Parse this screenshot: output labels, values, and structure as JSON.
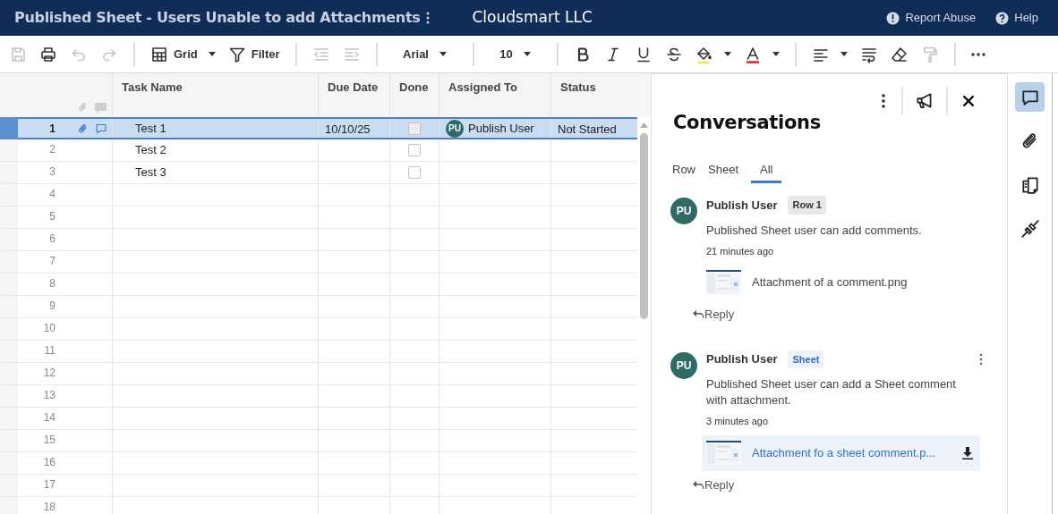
{
  "header": {
    "title": "Published Sheet - Users Unable to add Attachments",
    "company": "Cloudsmart LLC",
    "links": [
      {
        "kind": "report",
        "label": "Report Abuse"
      },
      {
        "kind": "help",
        "label": "Help"
      }
    ]
  },
  "toolbar": [
    {
      "kind": "save",
      "disabled": true
    },
    {
      "kind": "print",
      "disabled": false
    },
    {
      "kind": "undo",
      "disabled": true
    },
    {
      "kind": "redo",
      "disabled": true
    },
    {
      "kind": "sep"
    },
    {
      "kind": "grid",
      "label": "Grid",
      "disabled": false
    },
    {
      "kind": "filter",
      "label": "Filter",
      "disabled": false
    },
    {
      "kind": "sep"
    },
    {
      "kind": "outdent",
      "disabled": true
    },
    {
      "kind": "indent",
      "disabled": true
    },
    {
      "kind": "sep"
    },
    {
      "kind": "font",
      "label": "Arial",
      "disabled": false
    },
    {
      "kind": "sep"
    },
    {
      "kind": "size",
      "label": "10",
      "disabled": false
    },
    {
      "kind": "sep"
    },
    {
      "kind": "bold",
      "disabled": false
    },
    {
      "kind": "italic",
      "disabled": false
    },
    {
      "kind": "underline",
      "disabled": false
    },
    {
      "kind": "strike",
      "disabled": false
    },
    {
      "kind": "fill",
      "disabled": false
    },
    {
      "kind": "textcolor",
      "disabled": false
    },
    {
      "kind": "sep"
    },
    {
      "kind": "align",
      "disabled": false
    },
    {
      "kind": "wrap",
      "disabled": false
    },
    {
      "kind": "eraser",
      "disabled": false
    },
    {
      "kind": "paint",
      "disabled": true
    },
    {
      "kind": "sep"
    },
    {
      "kind": "more",
      "disabled": false
    }
  ],
  "grid": {
    "columns": [
      "Task Name",
      "Due Date",
      "Done",
      "Assigned To",
      "Status"
    ],
    "rows": [
      {
        "number": "1",
        "selected": true,
        "attachment": true,
        "comment": true,
        "task": "Test 1",
        "due": "10/10/25",
        "done": false,
        "assigned": {
          "initials": "PU",
          "name": "Publish User"
        },
        "status": "Not Started"
      },
      {
        "number": "2",
        "selected": false,
        "attachment": false,
        "comment": false,
        "task": "Test 2",
        "done": false
      },
      {
        "number": "3",
        "selected": false,
        "attachment": false,
        "comment": false,
        "task": "Test 3",
        "done": false
      },
      {
        "number": "4",
        "selected": false
      },
      {
        "number": "5",
        "selected": false
      },
      {
        "number": "6",
        "selected": false
      },
      {
        "number": "7",
        "selected": false
      },
      {
        "number": "8",
        "selected": false
      },
      {
        "number": "9",
        "selected": false
      },
      {
        "number": "10",
        "selected": false
      },
      {
        "number": "11",
        "selected": false
      },
      {
        "number": "12",
        "selected": false
      },
      {
        "number": "13",
        "selected": false
      },
      {
        "number": "14",
        "selected": false
      },
      {
        "number": "15",
        "selected": false
      },
      {
        "number": "16",
        "selected": false
      },
      {
        "number": "17",
        "selected": false
      },
      {
        "number": "18",
        "selected": false
      }
    ]
  },
  "conversations": {
    "title": "Conversations",
    "tabs": [
      {
        "label": "Row",
        "selected": false
      },
      {
        "label": "Sheet",
        "selected": false
      },
      {
        "label": "All",
        "selected": true
      }
    ],
    "comments": [
      {
        "initials": "PU",
        "author": "Publish User",
        "tag": {
          "kind": "row",
          "label": "Row 1"
        },
        "menu": false,
        "text": "Published Sheet user can add comments.",
        "time": "21 minutes ago",
        "attachment": {
          "name": "Attachment of a comment.png",
          "highlighted": false
        },
        "reply": "Reply"
      },
      {
        "initials": "PU",
        "author": "Publish User",
        "tag": {
          "kind": "sheet",
          "label": "Sheet"
        },
        "menu": true,
        "text": "Published Sheet user can add a Sheet comment with attachment.",
        "time": "3 minutes ago",
        "attachment": {
          "name": "Attachment fo a sheet comment.p...",
          "highlighted": true
        },
        "reply": "Reply"
      }
    ]
  },
  "rail": [
    {
      "kind": "comments",
      "selected": true
    },
    {
      "kind": "attachments",
      "selected": false
    },
    {
      "kind": "summary",
      "selected": false
    },
    {
      "kind": "connections",
      "selected": false
    }
  ]
}
